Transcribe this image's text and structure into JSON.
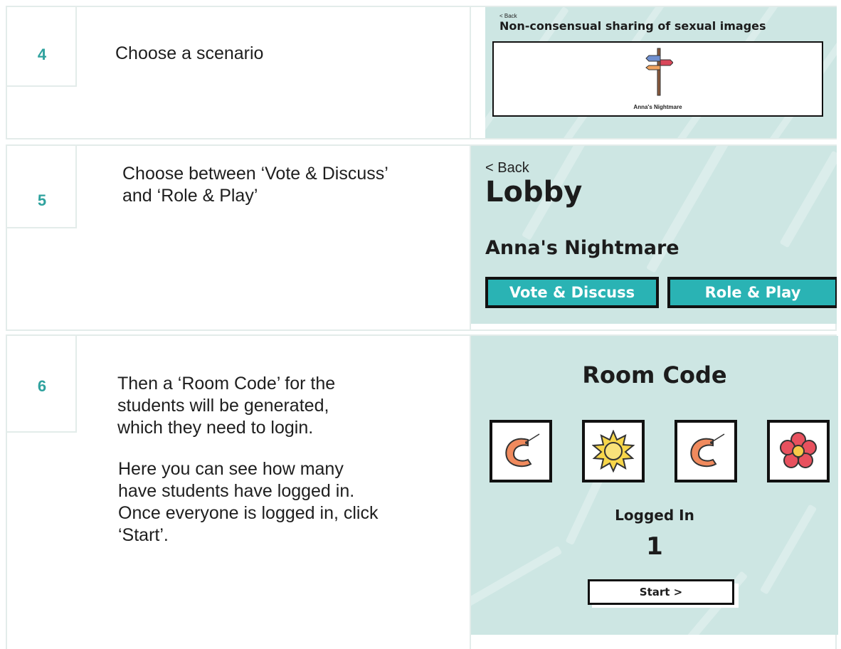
{
  "rows": [
    {
      "number": "4",
      "description": "Choose a scenario",
      "screen": {
        "back": "< Back",
        "title": "Non-consensual sharing of sexual images",
        "card_label": "Anna's Nightmare",
        "card_icon": "signpost-icon"
      }
    },
    {
      "number": "5",
      "description": "Choose between ‘Vote & Discuss’ and ‘Role & Play’",
      "screen": {
        "back": "< Back",
        "title": "Lobby",
        "scenario": "Anna's Nightmare",
        "button_vote": "Vote & Discuss",
        "button_role": "Role & Play"
      }
    },
    {
      "number": "6",
      "description": "Then a ‘Room Code’ for the students will be generated, which they need to login.",
      "description_2": "Here you can see how many have students have logged in. Once everyone is logged in, click ‘Start’.",
      "screen": {
        "title": "Room Code",
        "code_icons": [
          "shrimp-icon",
          "sun-icon",
          "shrimp-icon",
          "flower-icon"
        ],
        "logged_in_label": "Logged In",
        "logged_in_count": "1",
        "start_button": "Start >"
      }
    }
  ],
  "colors": {
    "accent_teal": "#2fa29e",
    "panel_bg": "#cde6e3",
    "button_teal": "#2ab3b4",
    "border": "#e3ecea"
  }
}
